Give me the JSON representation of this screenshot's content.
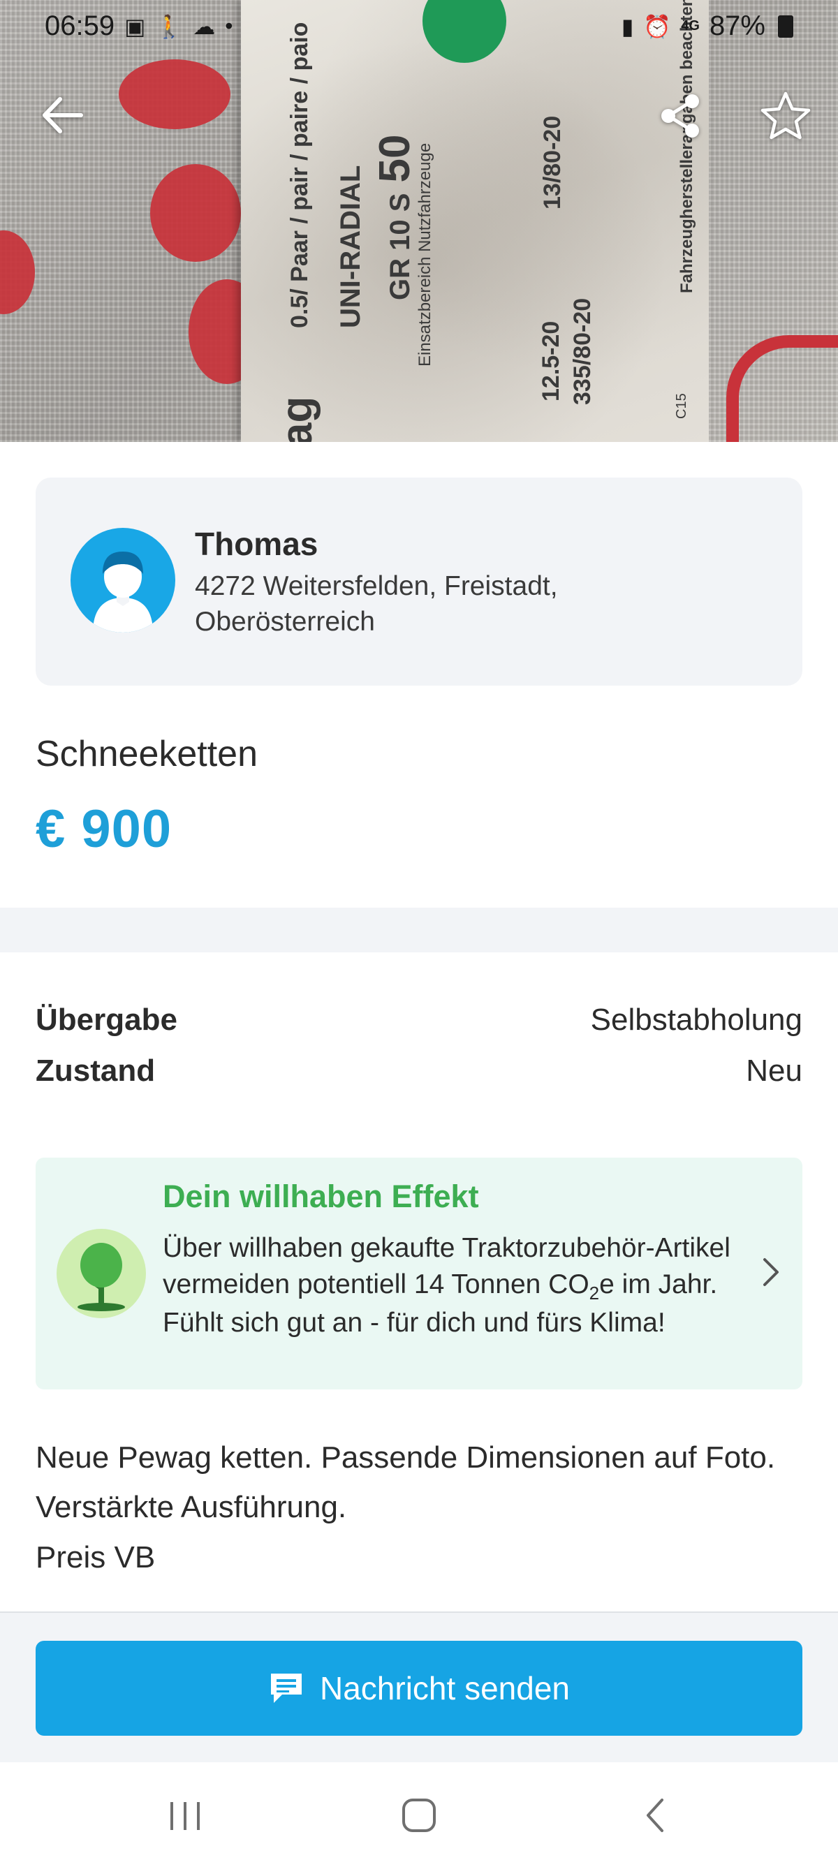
{
  "status_bar": {
    "time": "06:59",
    "network": "4G",
    "battery": "87%"
  },
  "photo_text": {
    "brand_fragment": "ag",
    "pair_text": "0.5/ Paar / pair / paire / paio",
    "tire_type": "UNI-RADIAL",
    "model": "GR 10 S",
    "model_suffix": "50",
    "usage": "Einsatzbereich Nutzfahrzeuge",
    "size_1": "13/80-20",
    "size_2": "12.5-20",
    "size_3": "335/80-20",
    "note": "Fahrzeugherstellerangaben beachten",
    "code": "C15"
  },
  "seller": {
    "name": "Thomas",
    "location_line1": "4272 Weitersfelden, Freistadt,",
    "location_line2": "Oberösterreich"
  },
  "listing": {
    "title": "Schneeketten",
    "price": "€ 900"
  },
  "attributes": [
    {
      "key": "Übergabe",
      "value": "Selbstabholung"
    },
    {
      "key": "Zustand",
      "value": "Neu"
    }
  ],
  "effect": {
    "title": "Dein willhaben Effekt",
    "text_part1": "Über willhaben gekaufte Traktorzubehör-Artikel vermeiden potentiell 14 Tonnen CO",
    "subscript": "2",
    "text_part2": "e im Jahr. Fühlt sich gut an - für dich und fürs Klima!"
  },
  "description": {
    "line1": "Neue Pewag ketten. Passende Dimensionen auf Foto. Verstärkte Ausführung.",
    "line2": "Preis VB"
  },
  "cta": {
    "label": "Nachricht senden"
  },
  "icons": {
    "back": "arrow-left-icon",
    "share": "share-icon",
    "favorite": "star-outline-icon",
    "message": "chat-bubble-icon",
    "tree": "tree-icon",
    "chevron": "chevron-right-icon",
    "nav_recents": "recents-icon",
    "nav_home": "home-icon",
    "nav_back": "nav-back-icon"
  },
  "colors": {
    "accent": "#16a4e4",
    "price": "#1e9fd8",
    "effect_green": "#3dae52",
    "effect_bg": "#eaf8f3",
    "card_bg": "#f2f4f7"
  }
}
